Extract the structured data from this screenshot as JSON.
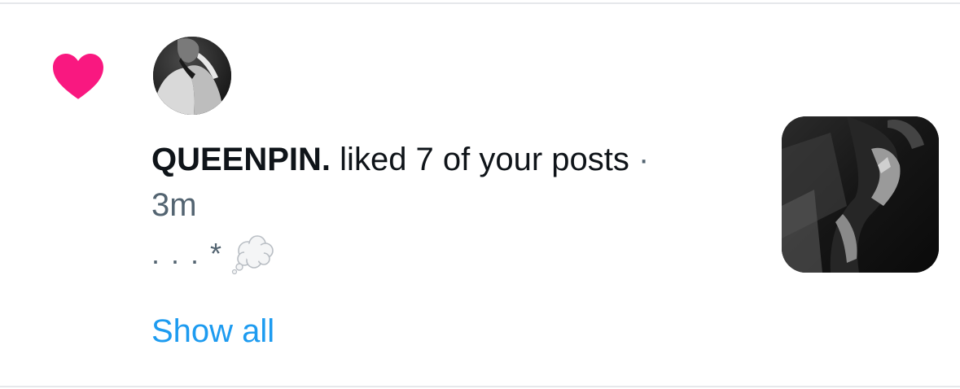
{
  "notification": {
    "username": "QUEENPIN.",
    "action": "liked 7 of your posts",
    "separator": "·",
    "time": "3m",
    "preview_text": ". . . *",
    "show_all_label": "Show all"
  },
  "colors": {
    "heart": "#f91880",
    "primary_text": "#0f1419",
    "secondary_text": "#536471",
    "link": "#1d9bf0",
    "divider": "#e6e8eb"
  },
  "icons": {
    "like": "heart-icon",
    "preview_emoji": "thought-balloon-icon"
  }
}
